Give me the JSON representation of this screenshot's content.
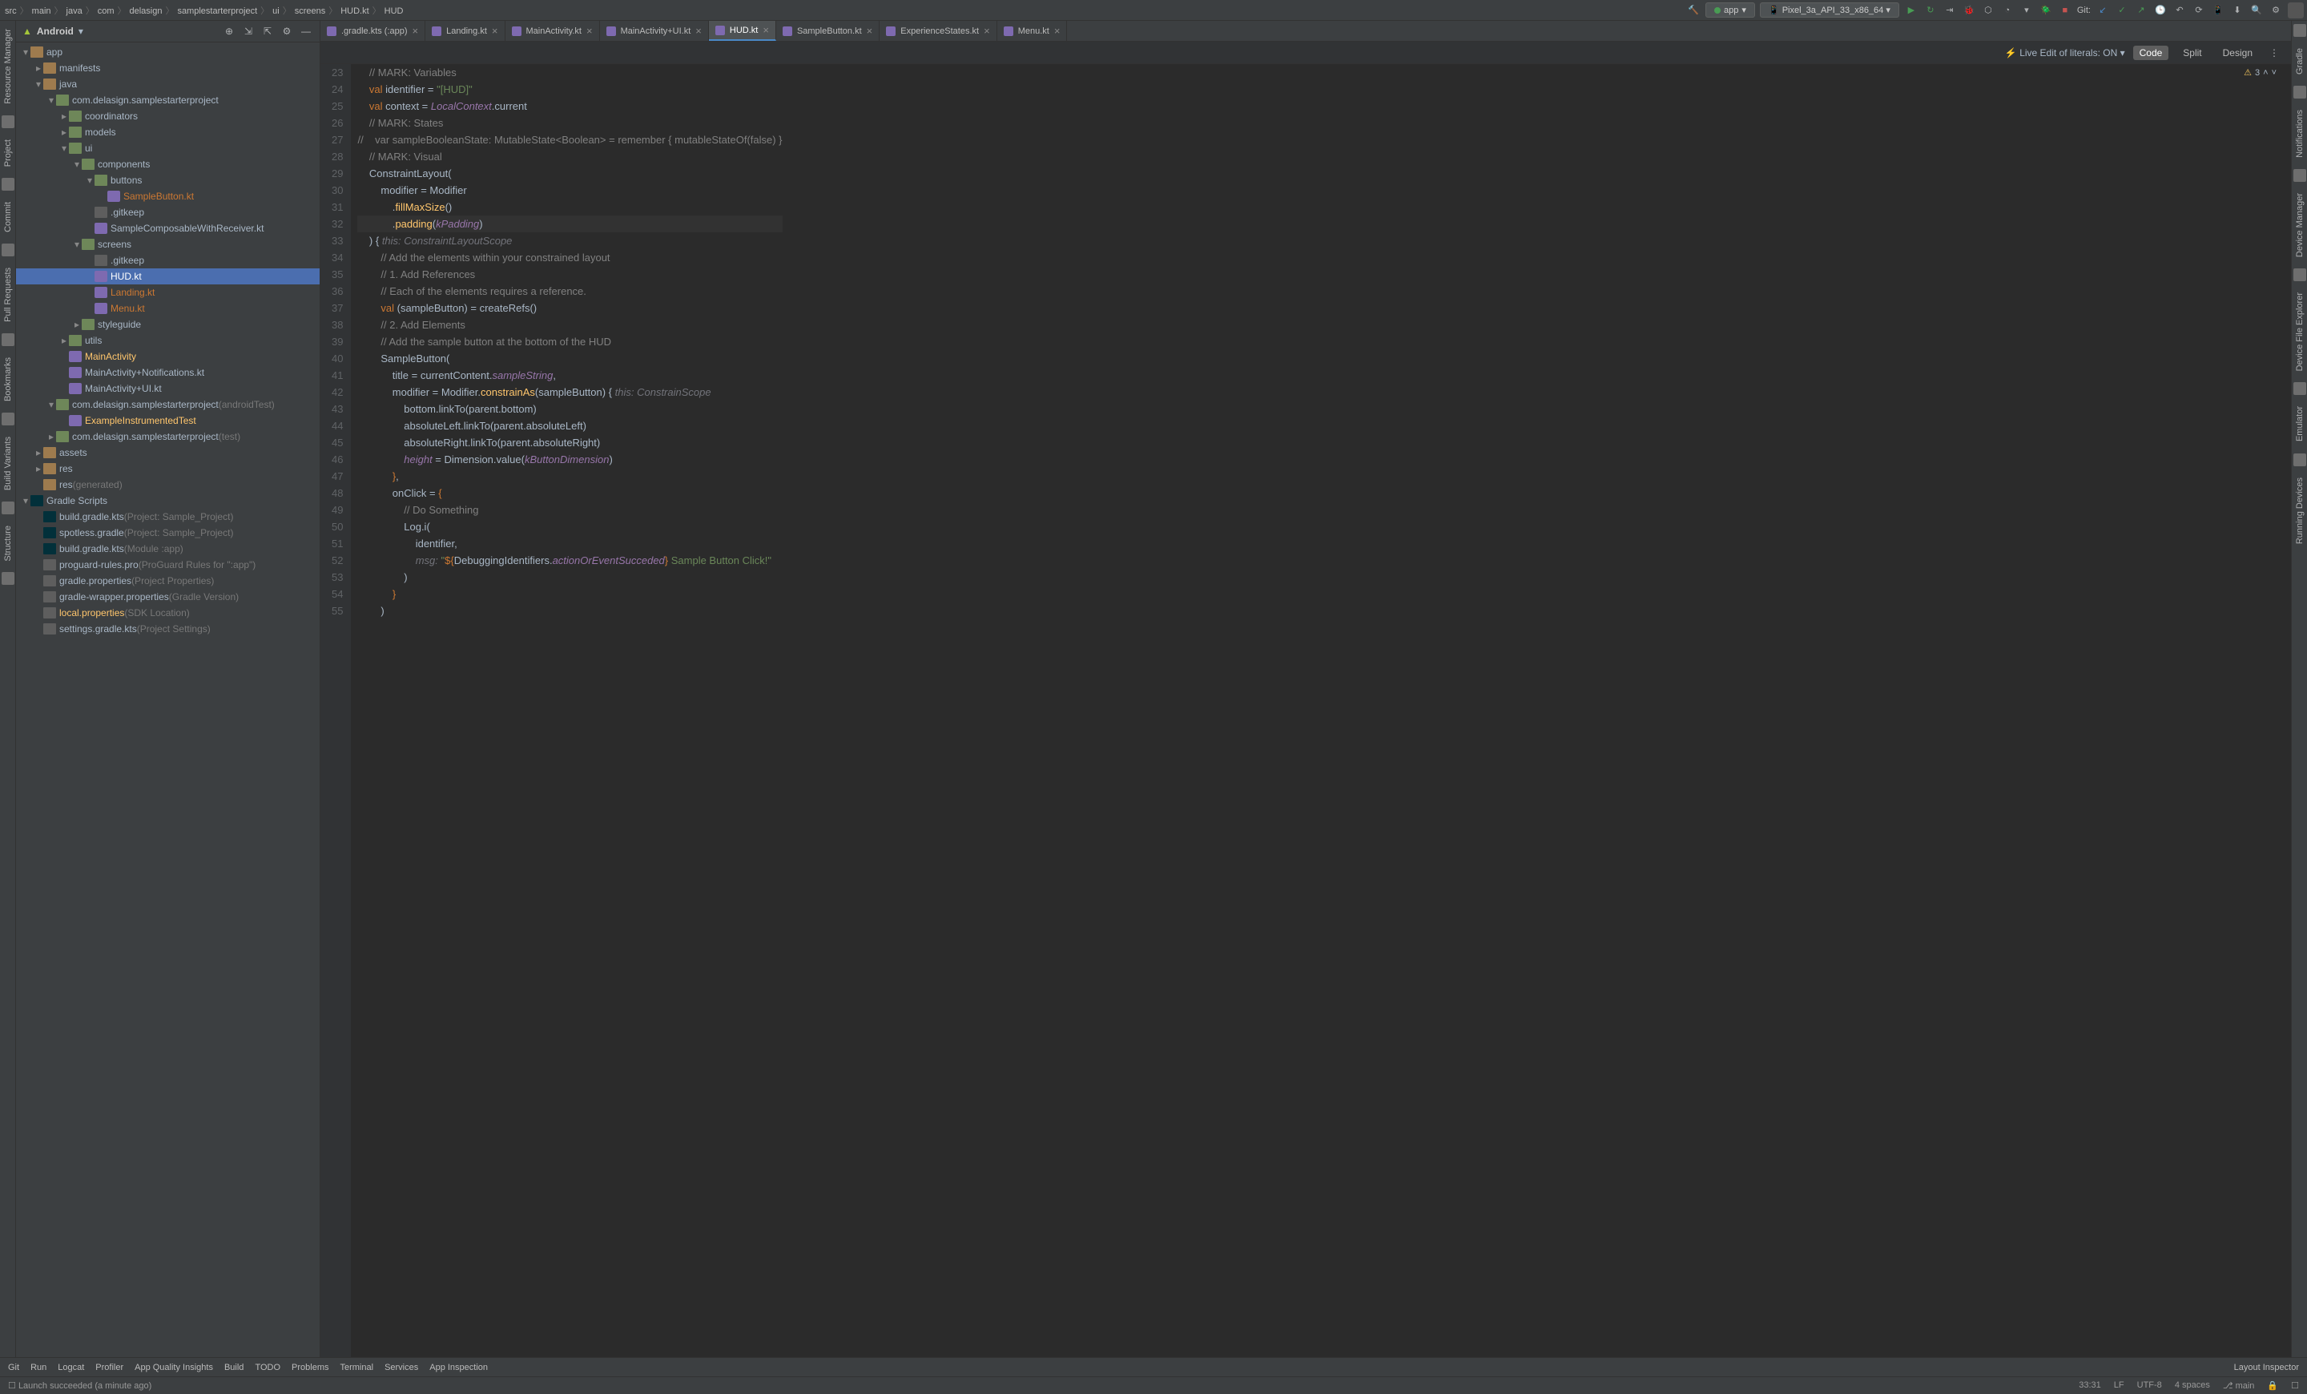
{
  "breadcrumbs": [
    "src",
    "main",
    "java",
    "com",
    "delasign",
    "samplestarterproject",
    "ui",
    "screens",
    "HUD.kt",
    "HUD"
  ],
  "toolbar": {
    "app_config": "app",
    "device": "Pixel_3a_API_33_x86_64",
    "git_label": "Git:"
  },
  "sidebar": {
    "title": "Android",
    "tree": [
      {
        "d": 0,
        "tw": "▾",
        "ic": "ic-folder",
        "label": "app",
        "cls": ""
      },
      {
        "d": 1,
        "tw": "▸",
        "ic": "ic-folder",
        "label": "manifests"
      },
      {
        "d": 1,
        "tw": "▾",
        "ic": "ic-folder",
        "label": "java"
      },
      {
        "d": 2,
        "tw": "▾",
        "ic": "ic-pkg",
        "label": "com.delasign.samplestarterproject"
      },
      {
        "d": 3,
        "tw": "▸",
        "ic": "ic-pkg",
        "label": "coordinators"
      },
      {
        "d": 3,
        "tw": "▸",
        "ic": "ic-pkg",
        "label": "models"
      },
      {
        "d": 3,
        "tw": "▾",
        "ic": "ic-pkg",
        "label": "ui"
      },
      {
        "d": 4,
        "tw": "▾",
        "ic": "ic-pkg",
        "label": "components"
      },
      {
        "d": 5,
        "tw": "▾",
        "ic": "ic-pkg",
        "label": "buttons"
      },
      {
        "d": 6,
        "tw": "",
        "ic": "ic-kt",
        "label": "SampleButton.kt",
        "cls": "orange"
      },
      {
        "d": 5,
        "tw": "",
        "ic": "ic-file",
        "label": ".gitkeep"
      },
      {
        "d": 5,
        "tw": "",
        "ic": "ic-kt",
        "label": "SampleComposableWithReceiver.kt"
      },
      {
        "d": 4,
        "tw": "▾",
        "ic": "ic-pkg",
        "label": "screens"
      },
      {
        "d": 5,
        "tw": "",
        "ic": "ic-file",
        "label": ".gitkeep"
      },
      {
        "d": 5,
        "tw": "",
        "ic": "ic-kt",
        "label": "HUD.kt",
        "sel": true
      },
      {
        "d": 5,
        "tw": "",
        "ic": "ic-kt",
        "label": "Landing.kt",
        "cls": "orange"
      },
      {
        "d": 5,
        "tw": "",
        "ic": "ic-kt",
        "label": "Menu.kt",
        "cls": "orange"
      },
      {
        "d": 4,
        "tw": "▸",
        "ic": "ic-pkg",
        "label": "styleguide"
      },
      {
        "d": 3,
        "tw": "▸",
        "ic": "ic-pkg",
        "label": "utils"
      },
      {
        "d": 3,
        "tw": "",
        "ic": "ic-kt",
        "label": "MainActivity",
        "cls": "yellow"
      },
      {
        "d": 3,
        "tw": "",
        "ic": "ic-kt",
        "label": "MainActivity+Notifications.kt"
      },
      {
        "d": 3,
        "tw": "",
        "ic": "ic-kt",
        "label": "MainActivity+UI.kt"
      },
      {
        "d": 2,
        "tw": "▾",
        "ic": "ic-pkg",
        "label": "com.delasign.samplestarterproject",
        "suffix": "(androidTest)"
      },
      {
        "d": 3,
        "tw": "",
        "ic": "ic-kt",
        "label": "ExampleInstrumentedTest",
        "cls": "yellow"
      },
      {
        "d": 2,
        "tw": "▸",
        "ic": "ic-pkg",
        "label": "com.delasign.samplestarterproject",
        "suffix": "(test)"
      },
      {
        "d": 1,
        "tw": "▸",
        "ic": "ic-folder",
        "label": "assets"
      },
      {
        "d": 1,
        "tw": "▸",
        "ic": "ic-folder",
        "label": "res"
      },
      {
        "d": 1,
        "tw": "",
        "ic": "ic-folder",
        "label": "res",
        "suffix": "(generated)"
      },
      {
        "d": 0,
        "tw": "▾",
        "ic": "ic-gradle",
        "label": "Gradle Scripts"
      },
      {
        "d": 1,
        "tw": "",
        "ic": "ic-gradle",
        "label": "build.gradle.kts",
        "suffix": "(Project: Sample_Project)"
      },
      {
        "d": 1,
        "tw": "",
        "ic": "ic-gradle",
        "label": "spotless.gradle",
        "suffix": "(Project: Sample_Project)"
      },
      {
        "d": 1,
        "tw": "",
        "ic": "ic-gradle",
        "label": "build.gradle.kts",
        "suffix": "(Module :app)"
      },
      {
        "d": 1,
        "tw": "",
        "ic": "ic-file",
        "label": "proguard-rules.pro",
        "suffix": "(ProGuard Rules for \":app\")"
      },
      {
        "d": 1,
        "tw": "",
        "ic": "ic-file",
        "label": "gradle.properties",
        "suffix": "(Project Properties)"
      },
      {
        "d": 1,
        "tw": "",
        "ic": "ic-file",
        "label": "gradle-wrapper.properties",
        "suffix": "(Gradle Version)"
      },
      {
        "d": 1,
        "tw": "",
        "ic": "ic-file",
        "label": "local.properties",
        "suffix": "(SDK Location)",
        "cls": "yellow"
      },
      {
        "d": 1,
        "tw": "",
        "ic": "ic-file",
        "label": "settings.gradle.kts",
        "suffix": "(Project Settings)"
      }
    ]
  },
  "tabs": [
    {
      "label": ".gradle.kts (:app)"
    },
    {
      "label": "Landing.kt"
    },
    {
      "label": "MainActivity.kt"
    },
    {
      "label": "MainActivity+UI.kt"
    },
    {
      "label": "HUD.kt",
      "active": true
    },
    {
      "label": "SampleButton.kt"
    },
    {
      "label": "ExperienceStates.kt"
    },
    {
      "label": "Menu.kt"
    }
  ],
  "modebar": {
    "live_edit": "Live Edit of literals: ON",
    "code": "Code",
    "split": "Split",
    "design": "Design",
    "warn_count": "3"
  },
  "code": {
    "start": 23,
    "lines": [
      {
        "html": "    <span class='c-cmt'>// MARK: Variables</span>"
      },
      {
        "html": "    <span class='c-kw'>val</span> identifier = <span class='c-str'>\"[HUD]\"</span>"
      },
      {
        "html": "    <span class='c-kw'>val</span> context = <span class='c-it'>LocalContext</span>.current"
      },
      {
        "html": "    <span class='c-cmt'>// MARK: States</span>"
      },
      {
        "html": "<span class='c-cmt'>//    var sampleBooleanState: MutableState&lt;Boolean&gt; = remember { mutableStateOf(false) }</span>"
      },
      {
        "html": "    <span class='c-cmt'>// MARK: Visual</span>"
      },
      {
        "html": "    ConstraintLayout("
      },
      {
        "html": "        modifier = Modifier"
      },
      {
        "html": "            .<span class='c-fn'>fillMaxSize</span>()"
      },
      {
        "html": "            .<span class='c-fn'>padding</span>(<span class='c-it'>kPadding</span>)",
        "hl": true
      },
      {
        "html": "    ) { <span class='c-param'>this: ConstraintLayoutScope</span>"
      },
      {
        "html": "        <span class='c-cmt'>// Add the elements within your constrained layout</span>"
      },
      {
        "html": "        <span class='c-cmt'>// 1. Add References</span>"
      },
      {
        "html": "        <span class='c-cmt'>// Each of the elements requires a reference.</span>"
      },
      {
        "html": "        <span class='c-kw'>val</span> (sampleButton) = createRefs()"
      },
      {
        "html": "        <span class='c-cmt'>// 2. Add Elements</span>"
      },
      {
        "html": "        <span class='c-cmt'>// Add the sample button at the bottom of the HUD</span>"
      },
      {
        "html": "        SampleButton("
      },
      {
        "html": "            title = currentContent.<span class='c-it'>sampleString</span>,"
      },
      {
        "html": "            modifier = Modifier.<span class='c-fn'>constrainAs</span>(sampleButton) { <span class='c-param'>this: ConstrainScope</span>"
      },
      {
        "html": "                bottom.linkTo(parent.bottom)"
      },
      {
        "html": "                absoluteLeft.linkTo(parent.absoluteLeft)"
      },
      {
        "html": "                absoluteRight.linkTo(parent.absoluteRight)"
      },
      {
        "html": "                <span class='c-it'>height</span> = Dimension.value(<span class='c-it'>kButtonDimension</span>)"
      },
      {
        "html": "            <span class='c-kw'>}</span>,"
      },
      {
        "html": "            onClick = <span class='c-kw'>{</span>"
      },
      {
        "html": "                <span class='c-cmt'>// Do Something</span>"
      },
      {
        "html": "                Log.i("
      },
      {
        "html": "                    identifier,"
      },
      {
        "html": "                    <span class='c-param'>msg:</span> <span class='c-str'>\"</span><span class='c-kw'>${</span>DebuggingIdentifiers.<span class='c-it'>actionOrEventSucceded</span><span class='c-kw'>}</span><span class='c-str'> Sample Button Click!\"</span>"
      },
      {
        "html": "                )"
      },
      {
        "html": "            <span class='c-kw'>}</span>"
      },
      {
        "html": "        )"
      }
    ]
  },
  "left_tools": [
    "Resource Manager",
    "Project",
    "Commit",
    "Pull Requests",
    "Bookmarks",
    "Build Variants",
    "Structure"
  ],
  "right_tools": [
    "Gradle",
    "Notifications",
    "Device Manager",
    "Device File Explorer",
    "Emulator",
    "Running Devices"
  ],
  "status_tools": [
    "Git",
    "Run",
    "Logcat",
    "Profiler",
    "App Quality Insights",
    "Build",
    "TODO",
    "Problems",
    "Terminal",
    "Services",
    "App Inspection"
  ],
  "status_right": {
    "layout_inspector": "Layout Inspector",
    "pos": "33:31",
    "lf": "LF",
    "enc": "UTF-8",
    "indent": "4 spaces",
    "branch": "main"
  },
  "bottom_msg": "Launch succeeded (a minute ago)"
}
